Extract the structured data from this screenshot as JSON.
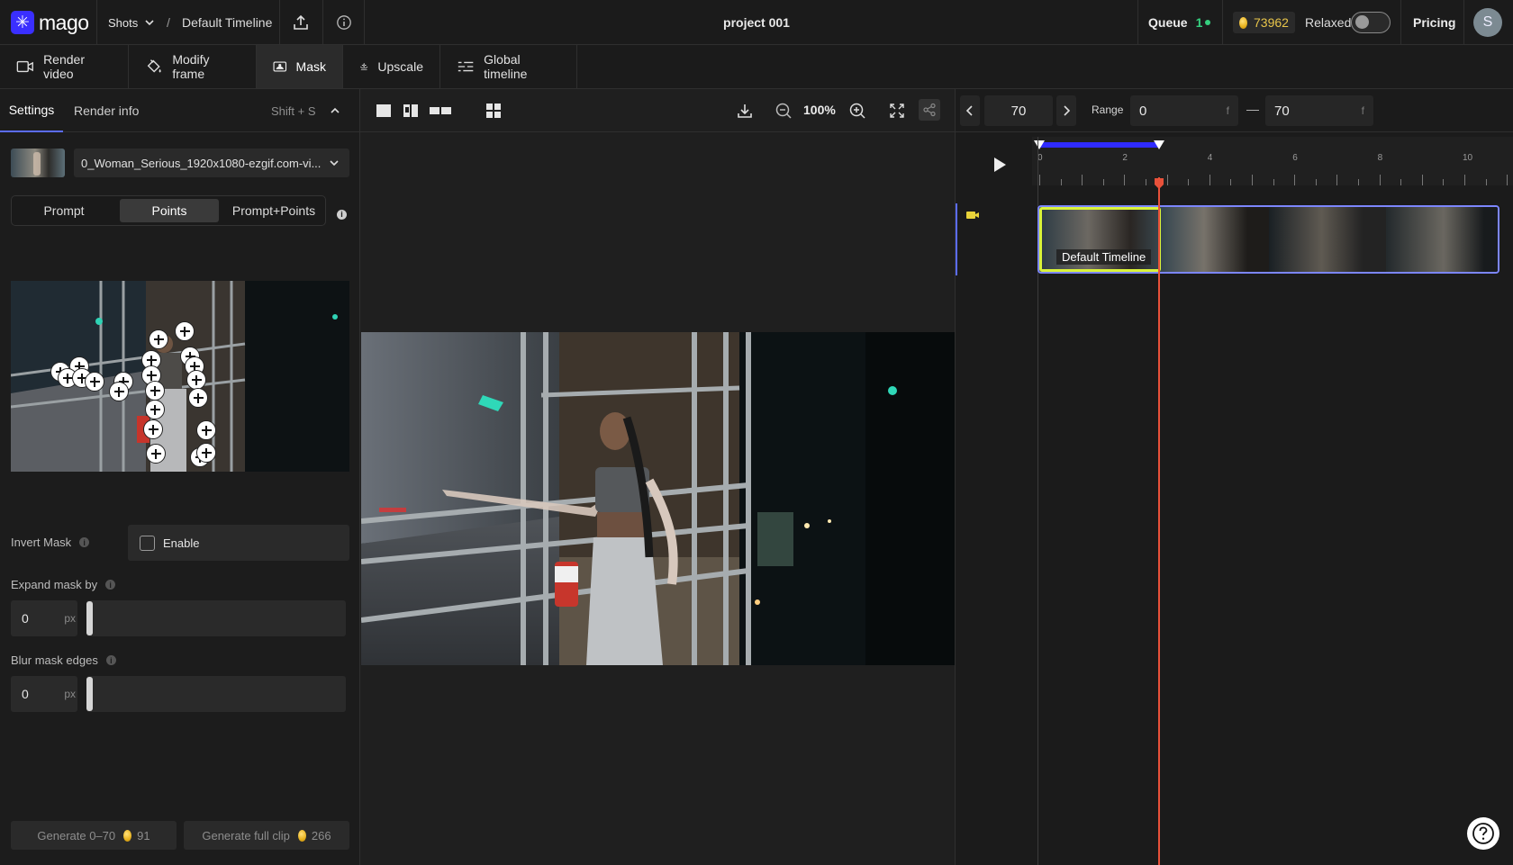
{
  "header": {
    "logo_text": "mago",
    "shots_label": "Shots",
    "separator": "/",
    "breadcrumb_timeline": "Default Timeline",
    "project_title": "project 001",
    "queue_label": "Queue",
    "queue_count": "1",
    "credits": "73962",
    "mode_label": "Relaxed",
    "mode_toggle_on": false,
    "pricing_label": "Pricing",
    "avatar_initial": "S"
  },
  "toolbar": {
    "render_video": "Render video",
    "modify_frame": "Modify frame",
    "mask": "Mask",
    "upscale": "Upscale",
    "global_timeline": "Global timeline",
    "active": "mask"
  },
  "left_panel": {
    "tabs": {
      "settings": "Settings",
      "render_info": "Render info",
      "shortcut": "Shift + S"
    },
    "file_name": "0_Woman_Serious_1920x1080-ezgif.com-vi...",
    "mode_tabs": {
      "prompt": "Prompt",
      "points": "Points",
      "prompt_points": "Prompt+Points",
      "active": "points"
    },
    "invert_mask": {
      "label": "Invert Mask",
      "checkbox_label": "Enable",
      "checked": false
    },
    "expand_mask": {
      "label": "Expand mask by",
      "value": "0",
      "unit": "px"
    },
    "blur_mask": {
      "label": "Blur mask edges",
      "value": "0",
      "unit": "px"
    },
    "generate_range": {
      "label": "Generate 0–70",
      "cost": "91"
    },
    "generate_full": {
      "label": "Generate full clip",
      "cost": "266"
    }
  },
  "viewer": {
    "zoom": "100%"
  },
  "timeline": {
    "current_frame": "70",
    "range_label": "Range",
    "range_start": "0",
    "range_unit_start": "f",
    "range_dash": "—",
    "range_end": "70",
    "range_unit_end": "f",
    "ruler_labels": [
      "0",
      "2",
      "4",
      "6",
      "8",
      "10"
    ],
    "clip_label": "Default Timeline"
  },
  "colors": {
    "accent": "#3a2fff",
    "selection_bar": "#2f2bff",
    "playhead": "#e8513a",
    "clip_highlight": "#d9f23a",
    "clip_border": "#7c86ff",
    "queue_dot": "#35d07f",
    "credits_text": "#e8c54a"
  }
}
